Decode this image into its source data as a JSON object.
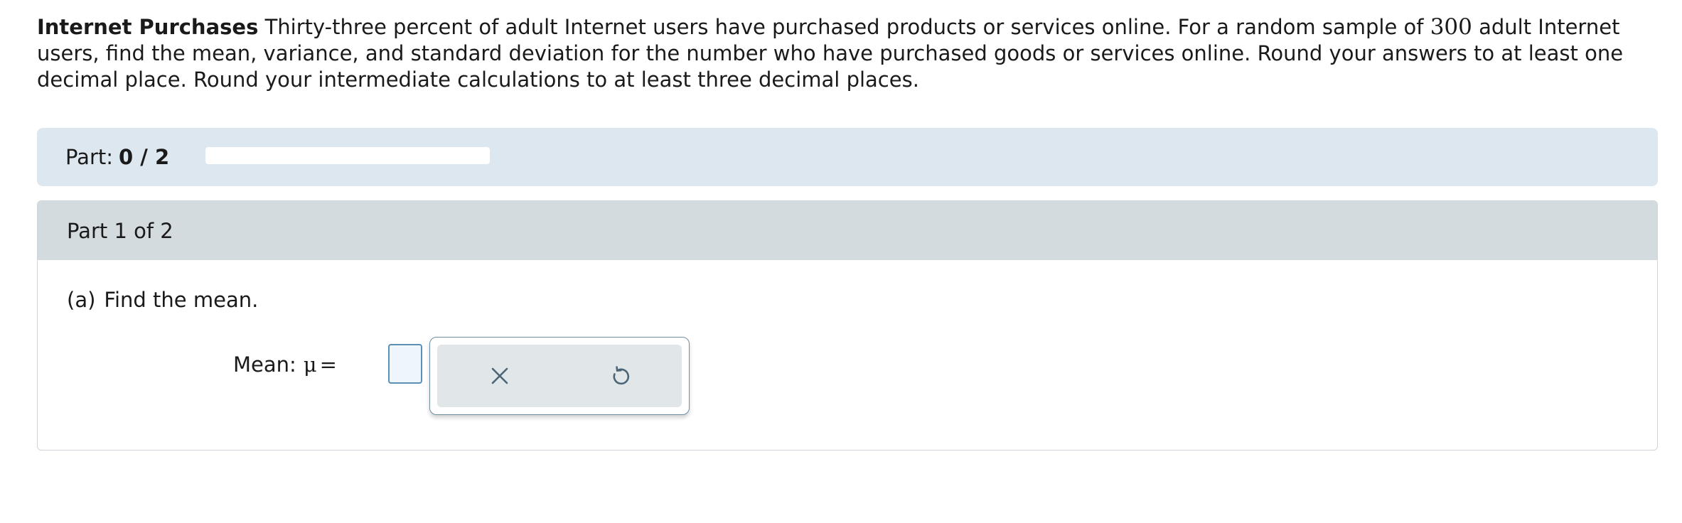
{
  "problem": {
    "title": "Internet Purchases",
    "text_before_number": "Thirty-three percent of adult Internet users have purchased products or services online. For a random sample of",
    "sample_size": "300",
    "text_after_number": "adult Internet users, find the mean, variance, and standard deviation for the number who have purchased goods or services online. Round your answers to at least one decimal place. Round your intermediate calculations to at least three decimal places."
  },
  "progress": {
    "label": "Part:",
    "count": "0 / 2",
    "completed_fraction": 0
  },
  "part": {
    "header": "Part 1 of 2",
    "question_letter": "(a)",
    "question_text": "Find the mean.",
    "answer_label": "Mean:",
    "symbol": "μ",
    "equals": "=",
    "answer_value": ""
  },
  "tools": {
    "clear_icon": "close-icon",
    "undo_icon": "undo-icon"
  },
  "colors": {
    "progress_bar_bg": "#dde7ef",
    "part_header_bg": "#d4dbdf",
    "input_border": "#5b8fb4",
    "input_bg": "#eef6fb",
    "icon_color": "#4b6577"
  }
}
